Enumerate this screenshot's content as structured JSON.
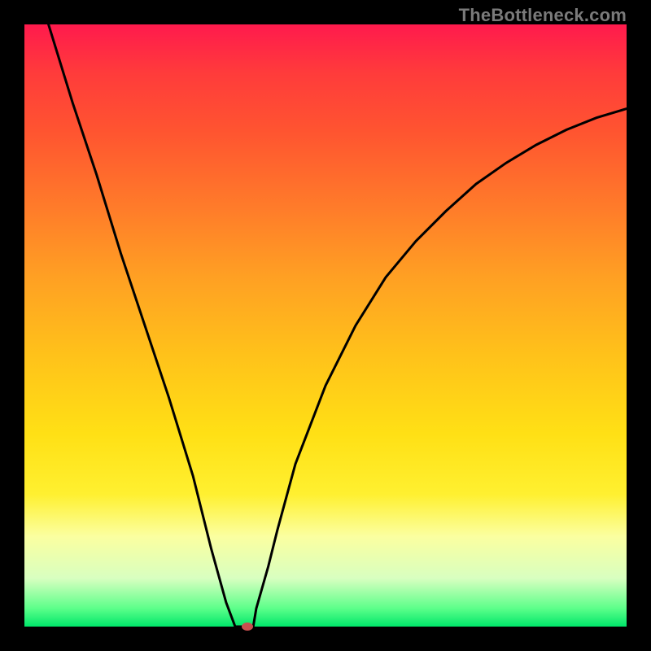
{
  "watermark": {
    "text": "TheBottleneck.com"
  },
  "chart_data": {
    "type": "line",
    "title": "",
    "xlabel": "",
    "ylabel": "",
    "xlim": [
      0,
      100
    ],
    "ylim": [
      0,
      100
    ],
    "series": [
      {
        "name": "bottleneck-curve",
        "x": [
          4,
          8,
          12,
          16,
          20,
          24,
          28,
          31,
          33.5,
          35,
          36.5,
          38,
          38.5,
          40.5,
          42,
          45,
          50,
          55,
          60,
          65,
          70,
          75,
          80,
          85,
          90,
          95,
          100
        ],
        "values": [
          100,
          87,
          75,
          62,
          50,
          38,
          25,
          13,
          4,
          0,
          0,
          0,
          3,
          10,
          16,
          27,
          40,
          50,
          58,
          64,
          69,
          73.5,
          77,
          80,
          82.5,
          84.5,
          86
        ]
      }
    ],
    "marker": {
      "x": 37,
      "y": 0
    },
    "gradient_stops": [
      {
        "pos": 0,
        "color": "#ff1a4d"
      },
      {
        "pos": 50,
        "color": "#ffd21a"
      },
      {
        "pos": 100,
        "color": "#00e66a"
      }
    ]
  }
}
